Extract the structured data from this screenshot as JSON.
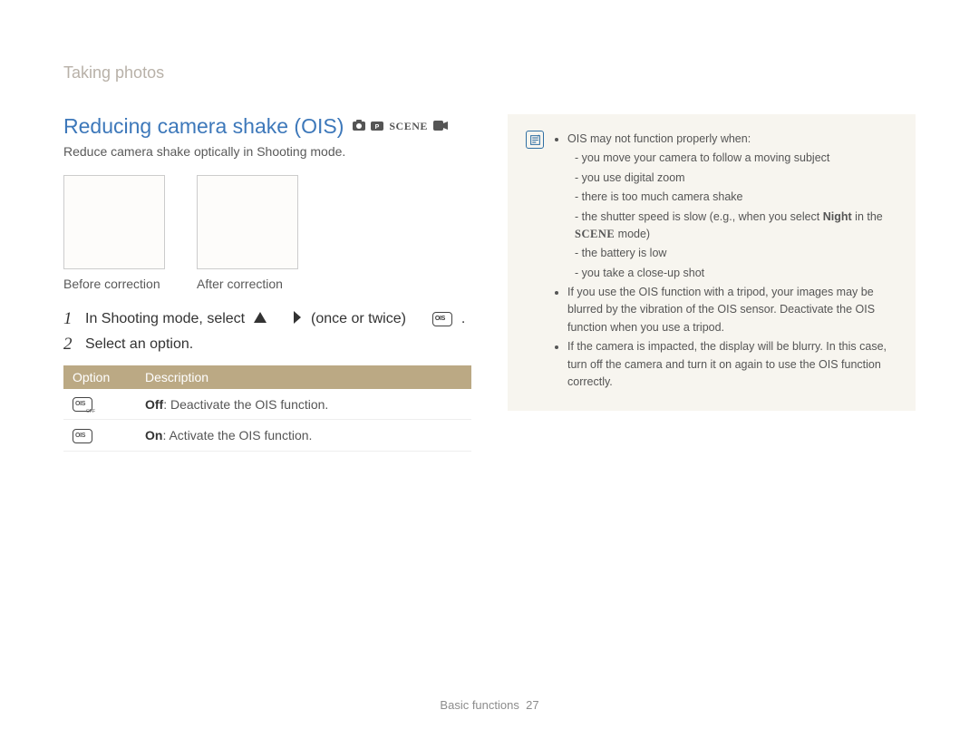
{
  "header": {
    "section": "Taking photos"
  },
  "title": "Reducing camera shake (OIS)",
  "mode_icons": [
    "camera-icon",
    "camera-p-icon",
    "scene-icon",
    "video-icon"
  ],
  "intro": "Reduce camera shake optically in Shooting mode.",
  "thumbnails": {
    "before_label": "Before correction",
    "after_label": "After correction"
  },
  "steps": [
    {
      "num": "1",
      "prefix": "In Shooting mode, select",
      "icons_inline": [
        "triangle-up-icon",
        "chevron-right-icon"
      ],
      "mid": "(once or twice)",
      "suffix_icon": "ois-on-icon",
      "suffix": "."
    },
    {
      "num": "2",
      "text": "Select an option."
    }
  ],
  "table": {
    "head": {
      "option": "Option",
      "description": "Description"
    },
    "rows": [
      {
        "icon": "ois-off-icon",
        "bold": "Off",
        "text": ": Deactivate the OIS function."
      },
      {
        "icon": "ois-on-icon",
        "bold": "On",
        "text": ": Activate the OIS function."
      }
    ]
  },
  "note": {
    "top_intro": "OIS may not function properly when:",
    "sub": [
      "you move your camera to follow a moving subject",
      "you use digital zoom",
      "there is too much camera shake",
      {
        "prefix": "the shutter speed is slow (e.g., when you select ",
        "bold": "Night",
        "mid": " in the ",
        "scene": "SCENE",
        "suffix": " mode)"
      },
      "the battery is low",
      "you take a close-up shot"
    ],
    "bullets": [
      "If you use the OIS function with a tripod, your images may be blurred by the vibration of the OIS sensor. Deactivate the OIS function when you use a tripod.",
      "If the camera is impacted, the display will be blurry. In this case, turn off the camera and turn it on again to use the OIS function correctly."
    ]
  },
  "footer": {
    "label": "Basic functions",
    "page": "27"
  }
}
